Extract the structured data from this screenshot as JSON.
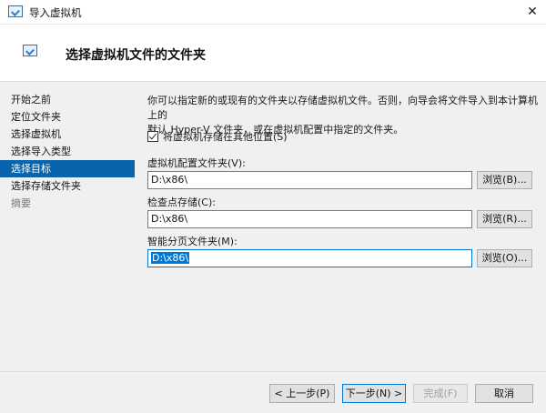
{
  "window": {
    "title": "导入虚拟机",
    "close_glyph": "✕"
  },
  "header": {
    "heading": "选择虚拟机文件的文件夹"
  },
  "sidebar": {
    "items": [
      {
        "label": "开始之前",
        "state": "normal"
      },
      {
        "label": "定位文件夹",
        "state": "normal"
      },
      {
        "label": "选择虚拟机",
        "state": "normal"
      },
      {
        "label": "选择导入类型",
        "state": "normal"
      },
      {
        "label": "选择目标",
        "state": "active"
      },
      {
        "label": "选择存储文件夹",
        "state": "normal"
      },
      {
        "label": "摘要",
        "state": "disabled"
      }
    ]
  },
  "main": {
    "description_line1": "你可以指定新的或现有的文件夹以存储虚拟机文件。否则，向导会将文件导入到本计算机上的",
    "description_line2": "默认 Hyper-V 文件夹，或在虚拟机配置中指定的文件夹。",
    "checkbox": {
      "label": "将虚拟机存储在其他位置(S)",
      "checked": true
    },
    "fields": {
      "config_folder": {
        "label": "虚拟机配置文件夹(V):",
        "value": "D:\\x86\\",
        "browse_label": "浏览(B)..."
      },
      "checkpoint_store": {
        "label": "检查点存储(C):",
        "value": "D:\\x86\\",
        "browse_label": "浏览(R)..."
      },
      "smart_paging": {
        "label": "智能分页文件夹(M):",
        "value": "D:\\x86\\",
        "browse_label": "浏览(O)..."
      }
    }
  },
  "footer": {
    "prev_label": "< 上一步(P)",
    "next_label": "下一步(N) >",
    "finish_label": "完成(F)",
    "cancel_label": "取消"
  },
  "colors": {
    "accent": "#0a64ad",
    "focus": "#0078d7",
    "panel": "#f0f0f0"
  }
}
